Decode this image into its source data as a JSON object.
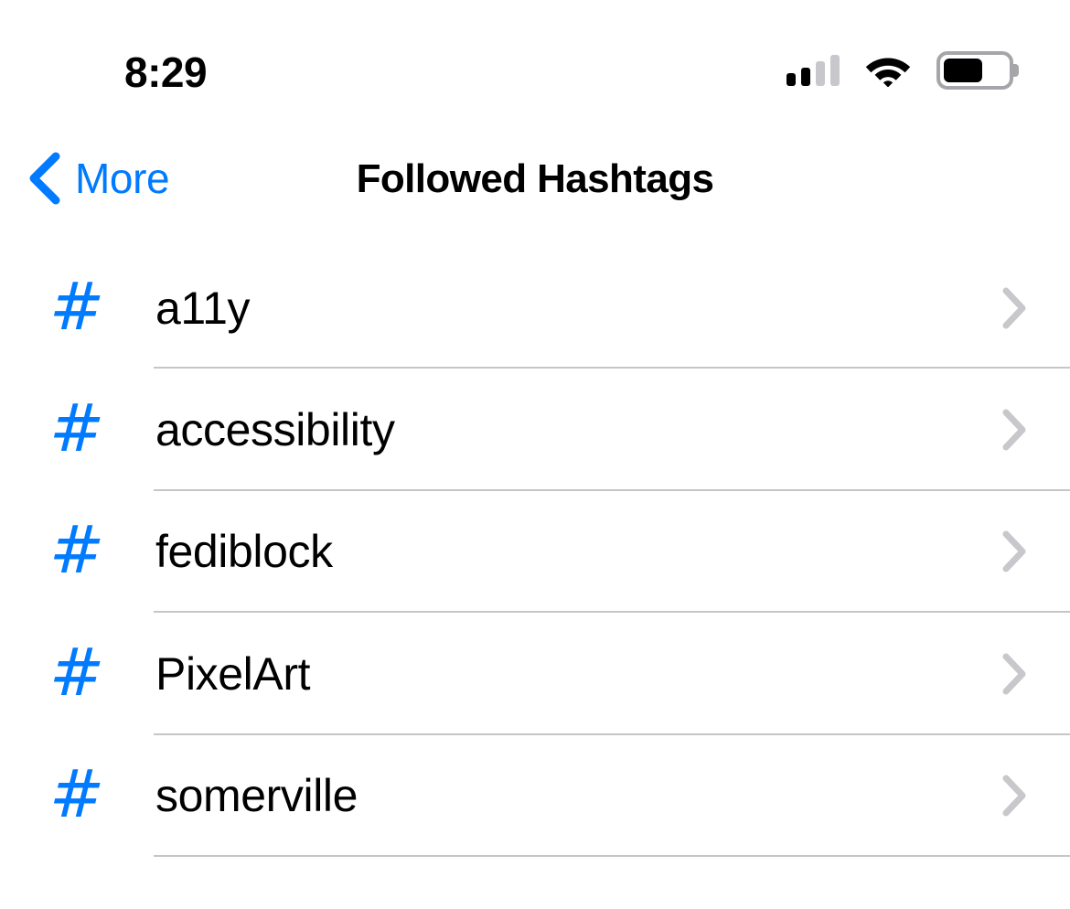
{
  "status_bar": {
    "time": "8:29",
    "signal": {
      "icon": "cellular-signal-icon",
      "bars_total": 4,
      "bars_active": 2
    },
    "wifi": {
      "icon": "wifi-icon",
      "strength": 3
    },
    "battery": {
      "icon": "battery-icon",
      "level_percent": 62
    }
  },
  "nav": {
    "back_label": "More",
    "back_icon": "chevron-left-icon",
    "title": "Followed Hashtags"
  },
  "list": {
    "rows": [
      {
        "icon": "hashtag-icon",
        "label": "a11y",
        "accessory": "chevron-right-icon"
      },
      {
        "icon": "hashtag-icon",
        "label": "accessibility",
        "accessory": "chevron-right-icon"
      },
      {
        "icon": "hashtag-icon",
        "label": "fediblock",
        "accessory": "chevron-right-icon"
      },
      {
        "icon": "hashtag-icon",
        "label": "PixelArt",
        "accessory": "chevron-right-icon"
      },
      {
        "icon": "hashtag-icon",
        "label": "somerville",
        "accessory": "chevron-right-icon"
      }
    ]
  },
  "colors": {
    "accent_blue": "#007AFF",
    "separator": "#C6C6C8",
    "chevron_gray": "#C7C7CC",
    "background": "#FFFFFF",
    "text_primary": "#000000"
  }
}
